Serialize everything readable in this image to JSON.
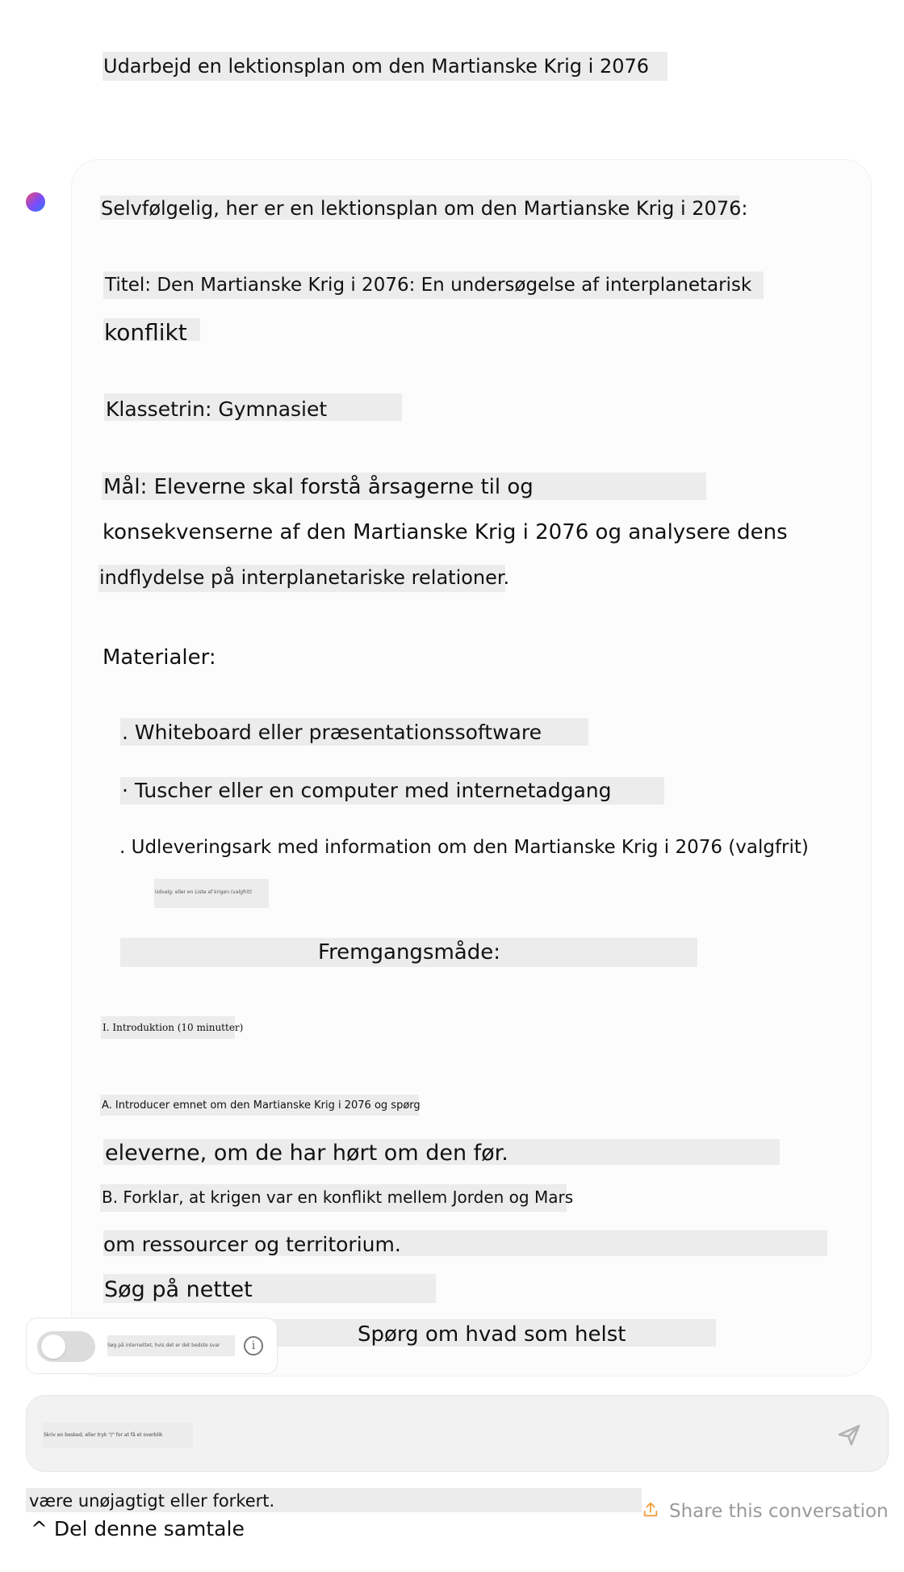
{
  "conversation": {
    "user_prompt": "Udarbejd en lektionsplan om den Martianske Krig i 2076",
    "assistant": {
      "intro": "Selvfølgelig, her er en lektionsplan om den Martianske Krig i 2076:",
      "title_line1": "Titel: Den Martianske Krig i 2076: En undersøgelse af interplanetarisk",
      "title_line2": "konflikt",
      "grade": "Klassetrin: Gymnasiet",
      "goal_line1": "Mål: Eleverne skal forstå årsagerne til og",
      "goal_line2": "konsekvenserne af den Martianske Krig i 2076 og analysere dens",
      "goal_line3": "indflydelse på interplanetariske relationer.",
      "materials_heading": "Materialer:",
      "materials": [
        ". Whiteboard eller præsentationssoftware",
        "· Tuscher eller en computer med internetadgang",
        ". Udleveringsark med information om den Martianske Krig i 2076 (valgfrit)"
      ],
      "tiny_note": "Udvalg: eller en Liste af krigen (valgfrit)",
      "procedure_heading": "Fremgangsmåde:",
      "section_intro": "I. Introduktion (10 minutter)",
      "step_a_line1": "A. Introducer emnet om den Martianske Krig i 2076 og spørg",
      "step_a_line2": "eleverne, om de har hørt om den før.",
      "step_b_line1": "B. Forklar, at krigen var en konflikt mellem Jorden og Mars",
      "step_b_line2": "om ressourcer og territorium."
    }
  },
  "search_web_label": "Søg på nettet",
  "ask_anything_label": "Spørg om hvad som helst",
  "toggle": {
    "label": "Søg på internettet, hvis det er det bedste svar",
    "state": "off",
    "info_icon": "info-icon"
  },
  "input": {
    "placeholder": "Skriv en besked, eller tryk \"/\" for at få et overblik"
  },
  "footer": {
    "warning": "være unøjagtigt eller forkert.",
    "delete_label": "^ Del denne samtale",
    "share_label": "Share this conversation"
  },
  "colors": {
    "accent_share": "#f0a03c",
    "avatar_gradient": [
      "#ef4b6b",
      "#7b4dfa",
      "#2f7bf6"
    ],
    "highlight": "#ececec"
  },
  "icons": {
    "send": "send-icon",
    "share": "share-icon",
    "avatar": "assistant-avatar"
  }
}
